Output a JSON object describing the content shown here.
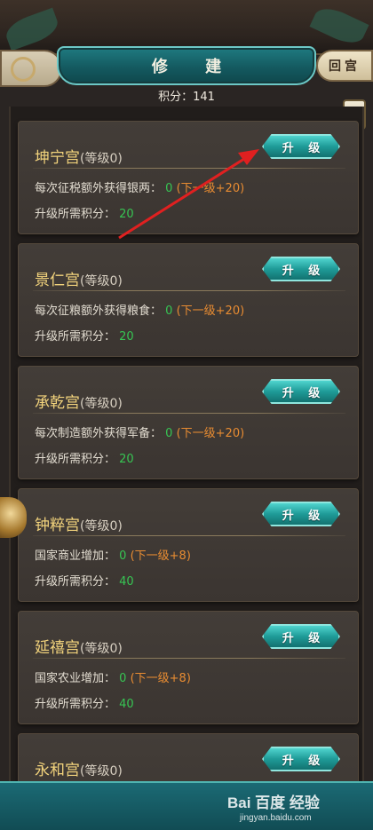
{
  "header": {
    "title": "修 建",
    "back_label": "回宫",
    "score_text": "积分：141",
    "help_label": "?"
  },
  "buildings": [
    {
      "name": "坤宁宫",
      "level": "(等级0)",
      "upgrade_label": "升 级",
      "row1_label": "每次征税额外获得银两：",
      "row1_value": "0",
      "row1_next": "(下一级+20)",
      "row2_label": "升级所需积分：",
      "row2_value": "20"
    },
    {
      "name": "景仁宫",
      "level": "(等级0)",
      "upgrade_label": "升 级",
      "row1_label": "每次征粮额外获得粮食：",
      "row1_value": "0",
      "row1_next": "(下一级+20)",
      "row2_label": "升级所需积分：",
      "row2_value": "20"
    },
    {
      "name": "承乾宫",
      "level": "(等级0)",
      "upgrade_label": "升 级",
      "row1_label": "每次制造额外获得军备：",
      "row1_value": "0",
      "row1_next": "(下一级+20)",
      "row2_label": "升级所需积分：",
      "row2_value": "20"
    },
    {
      "name": "钟粹宫",
      "level": "(等级0)",
      "upgrade_label": "升 级",
      "row1_label": "国家商业增加：",
      "row1_value": "0",
      "row1_next": "(下一级+8)",
      "row2_label": "升级所需积分：",
      "row2_value": "40"
    },
    {
      "name": "延禧宫",
      "level": "(等级0)",
      "upgrade_label": "升 级",
      "row1_label": "国家农业增加：",
      "row1_value": "0",
      "row1_next": "(下一级+8)",
      "row2_label": "升级所需积分：",
      "row2_value": "40"
    },
    {
      "name": "永和宫",
      "level": "(等级0)",
      "upgrade_label": "升 级"
    }
  ],
  "watermark": {
    "logo": "Bai 百度 经验",
    "url": "jingyan.baidu.com"
  },
  "colors": {
    "accent_teal": "#1f9b98",
    "name_gold": "#f2d37c",
    "value_green": "#37c453",
    "next_orange": "#e88c32",
    "arrow_red": "#e02020"
  }
}
